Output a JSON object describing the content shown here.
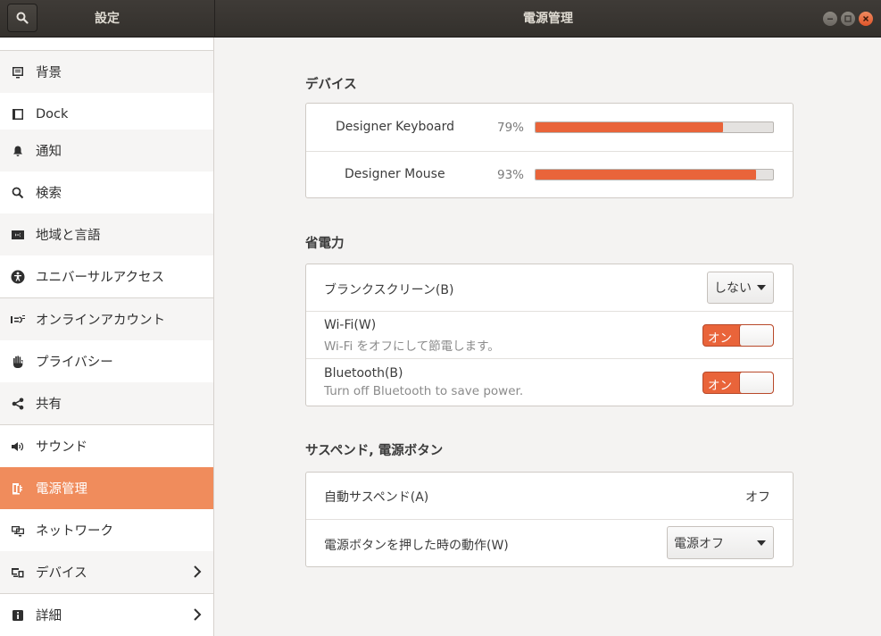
{
  "window": {
    "sidebar_title": "設定",
    "title": "電源管理"
  },
  "sidebar": {
    "items": [
      {
        "label": "背景",
        "icon": "background-icon"
      },
      {
        "label": "Dock",
        "icon": "dock-icon"
      },
      {
        "label": "通知",
        "icon": "bell-icon"
      },
      {
        "label": "検索",
        "icon": "search-icon"
      },
      {
        "label": "地域と言語",
        "icon": "region-icon"
      },
      {
        "label": "ユニバーサルアクセス",
        "icon": "accessibility-icon"
      },
      {
        "label": "オンラインアカウント",
        "icon": "online-accounts-icon"
      },
      {
        "label": "プライバシー",
        "icon": "privacy-hand-icon"
      },
      {
        "label": "共有",
        "icon": "share-icon"
      },
      {
        "label": "サウンド",
        "icon": "speaker-icon"
      },
      {
        "label": "電源管理",
        "icon": "power-icon",
        "active": true
      },
      {
        "label": "ネットワーク",
        "icon": "network-icon"
      },
      {
        "label": "デバイス",
        "icon": "devices-icon",
        "has_submenu": true
      },
      {
        "label": "詳細",
        "icon": "info-icon",
        "has_submenu": true
      }
    ]
  },
  "devices": {
    "title": "デバイス",
    "items": [
      {
        "name": "Designer Keyboard",
        "percent_label": "79%",
        "level": 0.79
      },
      {
        "name": "Designer Mouse",
        "percent_label": "93%",
        "level": 0.93
      }
    ]
  },
  "power_saving": {
    "title": "省電力",
    "blank_screen_label": "ブランクスクリーン(B)",
    "blank_screen_value": "しない",
    "wifi_label": "Wi-Fi(W)",
    "wifi_sub": "Wi-Fi をオフにして節電します。",
    "wifi_toggle": "オン",
    "bluetooth_label": "Bluetooth(B)",
    "bluetooth_sub": "Turn off Bluetooth to save power.",
    "bluetooth_toggle": "オン"
  },
  "suspend": {
    "title": "サスペンド, 電源ボタン",
    "auto_suspend_label": "自動サスペンド(A)",
    "auto_suspend_value": "オフ",
    "power_button_label": "電源ボタンを押した時の動作(W)",
    "power_button_value": "電源オフ"
  },
  "colors": {
    "accent": "#e9643a",
    "sidebar_active": "#f08c5c",
    "titlebar": "#3a3632"
  }
}
